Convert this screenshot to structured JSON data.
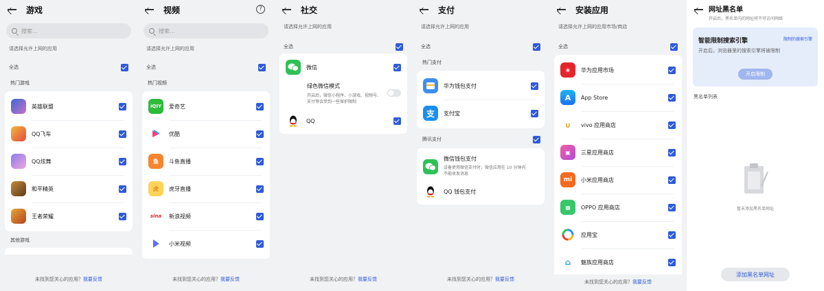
{
  "common": {
    "footer_text": "未找到您关心的应用？",
    "footer_link": "我要反馈",
    "select_all": "全选",
    "search_placeholder": "搜索…",
    "hint_allow": "请选择允许上网的应用"
  },
  "games": {
    "title": "游戏",
    "section_hot": "热门游戏",
    "section_other": "其他游戏",
    "items": [
      {
        "name": "英雄联盟",
        "icon": "lol-icon"
      },
      {
        "name": "QQ飞车",
        "icon": "qqspeed-icon"
      },
      {
        "name": "QQ炫舞",
        "icon": "qqdance-icon"
      },
      {
        "name": "和平精英",
        "icon": "peace-elite-icon"
      },
      {
        "name": "王者荣耀",
        "icon": "honor-of-kings-icon"
      }
    ]
  },
  "video": {
    "title": "视频",
    "section_hot": "热门视频",
    "items": [
      {
        "name": "爱奇艺",
        "icon": "iqiyi-icon"
      },
      {
        "name": "优酷",
        "icon": "youku-icon"
      },
      {
        "name": "斗鱼直播",
        "icon": "douyu-icon"
      },
      {
        "name": "虎牙直播",
        "icon": "huya-icon"
      },
      {
        "name": "新浪视频",
        "icon": "sina-icon"
      },
      {
        "name": "小米视频",
        "icon": "mi-video-icon"
      }
    ]
  },
  "social": {
    "title": "社交",
    "items": {
      "wechat": "微信",
      "green_mode": "绿色微信模式",
      "green_mode_desc": "开启后，微信小程序、小游戏、视频号、支付等会受到一些保护限制",
      "qq": "QQ"
    }
  },
  "payment": {
    "title": "支付",
    "section_hot": "热门支付",
    "section_tencent": "腾讯支付",
    "hot_items": [
      {
        "name": "华为钱包支付",
        "icon": "huawei-wallet-icon"
      },
      {
        "name": "支付宝",
        "icon": "alipay-icon"
      }
    ],
    "wechat_pay": "微信钱包支付",
    "wechat_pay_desc": "设备使用微信支付时，微信应用在 10 分钟内不能收发消息",
    "qq_pay": "QQ 钱包支付"
  },
  "stores": {
    "title": "安装应用",
    "hint": "请选择允许上网的应用市场/商店",
    "items": [
      {
        "name": "华为应用市场",
        "icon": "huawei-appgallery-icon"
      },
      {
        "name": "App Store",
        "icon": "app-store-icon"
      },
      {
        "name": "vivo 应用商店",
        "icon": "vivo-store-icon"
      },
      {
        "name": "三星应用商店",
        "icon": "samsung-store-icon"
      },
      {
        "name": "小米应用商店",
        "icon": "mi-store-icon"
      },
      {
        "name": "OPPO 应用商店",
        "icon": "oppo-store-icon"
      },
      {
        "name": "应用宝",
        "icon": "yingyongbao-icon"
      },
      {
        "name": "魅族应用商店",
        "icon": "meizu-store-icon"
      }
    ]
  },
  "blacklist": {
    "title": "网址黑名单",
    "subtitle": "开启后，黑名单内的网址将不可访问网络",
    "smart_title": "智能限制搜索引擎",
    "smart_link": "限制的搜索引擎",
    "smart_desc": "开启后，浏览器里的搜索引擎将被限制",
    "smart_button": "开启限制",
    "list_label": "黑名单列表",
    "empty_text": "暂未添加黑名单网址",
    "add_button": "添加黑名单网址"
  }
}
